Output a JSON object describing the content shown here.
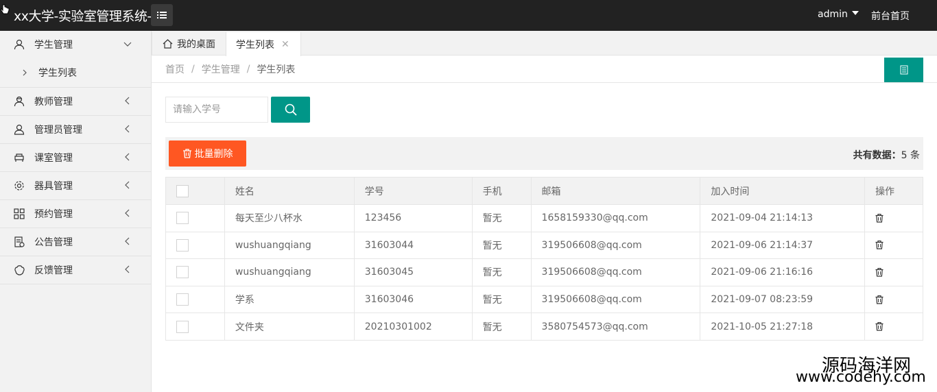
{
  "header": {
    "title": "xx大学-实验室管理系统-",
    "user": "admin",
    "home_link": "前台首页"
  },
  "sidebar": {
    "groups": [
      {
        "label": "学生管理",
        "icon": "user-icon",
        "expanded": true,
        "children": [
          {
            "label": "学生列表"
          }
        ]
      },
      {
        "label": "教师管理",
        "icon": "teacher-icon"
      },
      {
        "label": "管理员管理",
        "icon": "admin-icon"
      },
      {
        "label": "课室管理",
        "icon": "classroom-icon"
      },
      {
        "label": "器具管理",
        "icon": "gear-icon"
      },
      {
        "label": "预约管理",
        "icon": "grid-icon"
      },
      {
        "label": "公告管理",
        "icon": "notice-icon"
      },
      {
        "label": "反馈管理",
        "icon": "feedback-icon"
      }
    ]
  },
  "tabs": [
    {
      "label": "我的桌面"
    },
    {
      "label": "学生列表"
    }
  ],
  "breadcrumb": [
    "首页",
    "学生管理",
    "学生列表"
  ],
  "search": {
    "placeholder": "请输入学号",
    "value": ""
  },
  "toolbar": {
    "batch_delete": "批量删除",
    "total_label": "共有数据：",
    "total_count": "5",
    "total_unit": "条"
  },
  "table": {
    "headers": [
      "姓名",
      "学号",
      "手机",
      "邮箱",
      "加入时间",
      "操作"
    ],
    "rows": [
      {
        "name": "每天至少八杯水",
        "id": "123456",
        "phone": "暂无",
        "email": "1658159330@qq.com",
        "joined": "2021-09-04 21:14:13"
      },
      {
        "name": "wushuangqiang",
        "id": "31603044",
        "phone": "暂无",
        "email": "319506608@qq.com",
        "joined": "2021-09-06 21:14:37"
      },
      {
        "name": "wushuangqiang",
        "id": "31603045",
        "phone": "暂无",
        "email": "319506608@qq.com",
        "joined": "2021-09-06 21:16:16"
      },
      {
        "name": "学系",
        "id": "31603046",
        "phone": "暂无",
        "email": "319506608@qq.com",
        "joined": "2021-09-07 08:23:59"
      },
      {
        "name": "文件夹",
        "id": "20210301002",
        "phone": "暂无",
        "email": "3580754573@qq.com",
        "joined": "2021-10-05 21:27:18"
      }
    ]
  },
  "watermark": {
    "cn": "源码海洋网",
    "en": "www.codehy.com"
  },
  "colors": {
    "topbar": "#222222",
    "primary": "#009688",
    "danger": "#ff5722",
    "sidebar": "#f2f2f2"
  }
}
